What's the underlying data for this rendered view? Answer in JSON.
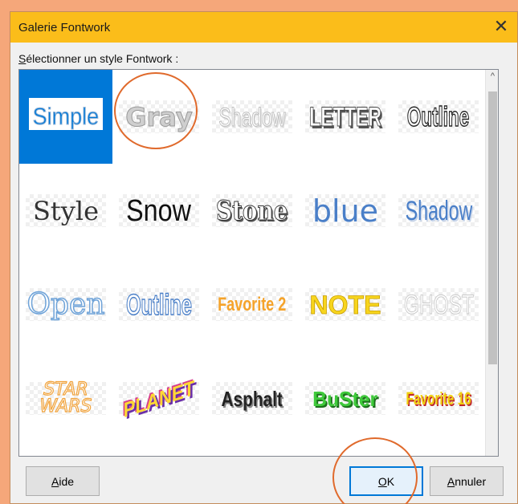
{
  "dialog": {
    "title": "Galerie Fontwork",
    "close_glyph": "✕",
    "select_label_first": "S",
    "select_label_rest": "électionner un style Fontwork :"
  },
  "gallery": {
    "scroll_up_glyph": "^",
    "selected_index": 0,
    "items": [
      {
        "label": "Simple"
      },
      {
        "label": "Gray"
      },
      {
        "label": "Shadow"
      },
      {
        "label": "LETTER"
      },
      {
        "label": "Outline"
      },
      {
        "label": "Style"
      },
      {
        "label": "Snow"
      },
      {
        "label": "Stone"
      },
      {
        "label": "blue"
      },
      {
        "label": "Shadow"
      },
      {
        "label": "Open"
      },
      {
        "label": "Outline"
      },
      {
        "label": "Favorite 2"
      },
      {
        "label": "NOTE"
      },
      {
        "label": "GHOST"
      },
      {
        "label": "STAR WARS"
      },
      {
        "label": "PLANET"
      },
      {
        "label": "Asphalt"
      },
      {
        "label": "BuSter"
      },
      {
        "label": "Favorite 16"
      }
    ]
  },
  "buttons": {
    "help_first": "A",
    "help_rest": "ide",
    "ok_first": "O",
    "ok_rest": "K",
    "cancel_first": "A",
    "cancel_rest": "nnuler"
  },
  "colors": {
    "title_bar": "#fbbd1a",
    "selection": "#0078d7",
    "annotation_circle": "#e06a2c",
    "background": "#f5a77a"
  }
}
